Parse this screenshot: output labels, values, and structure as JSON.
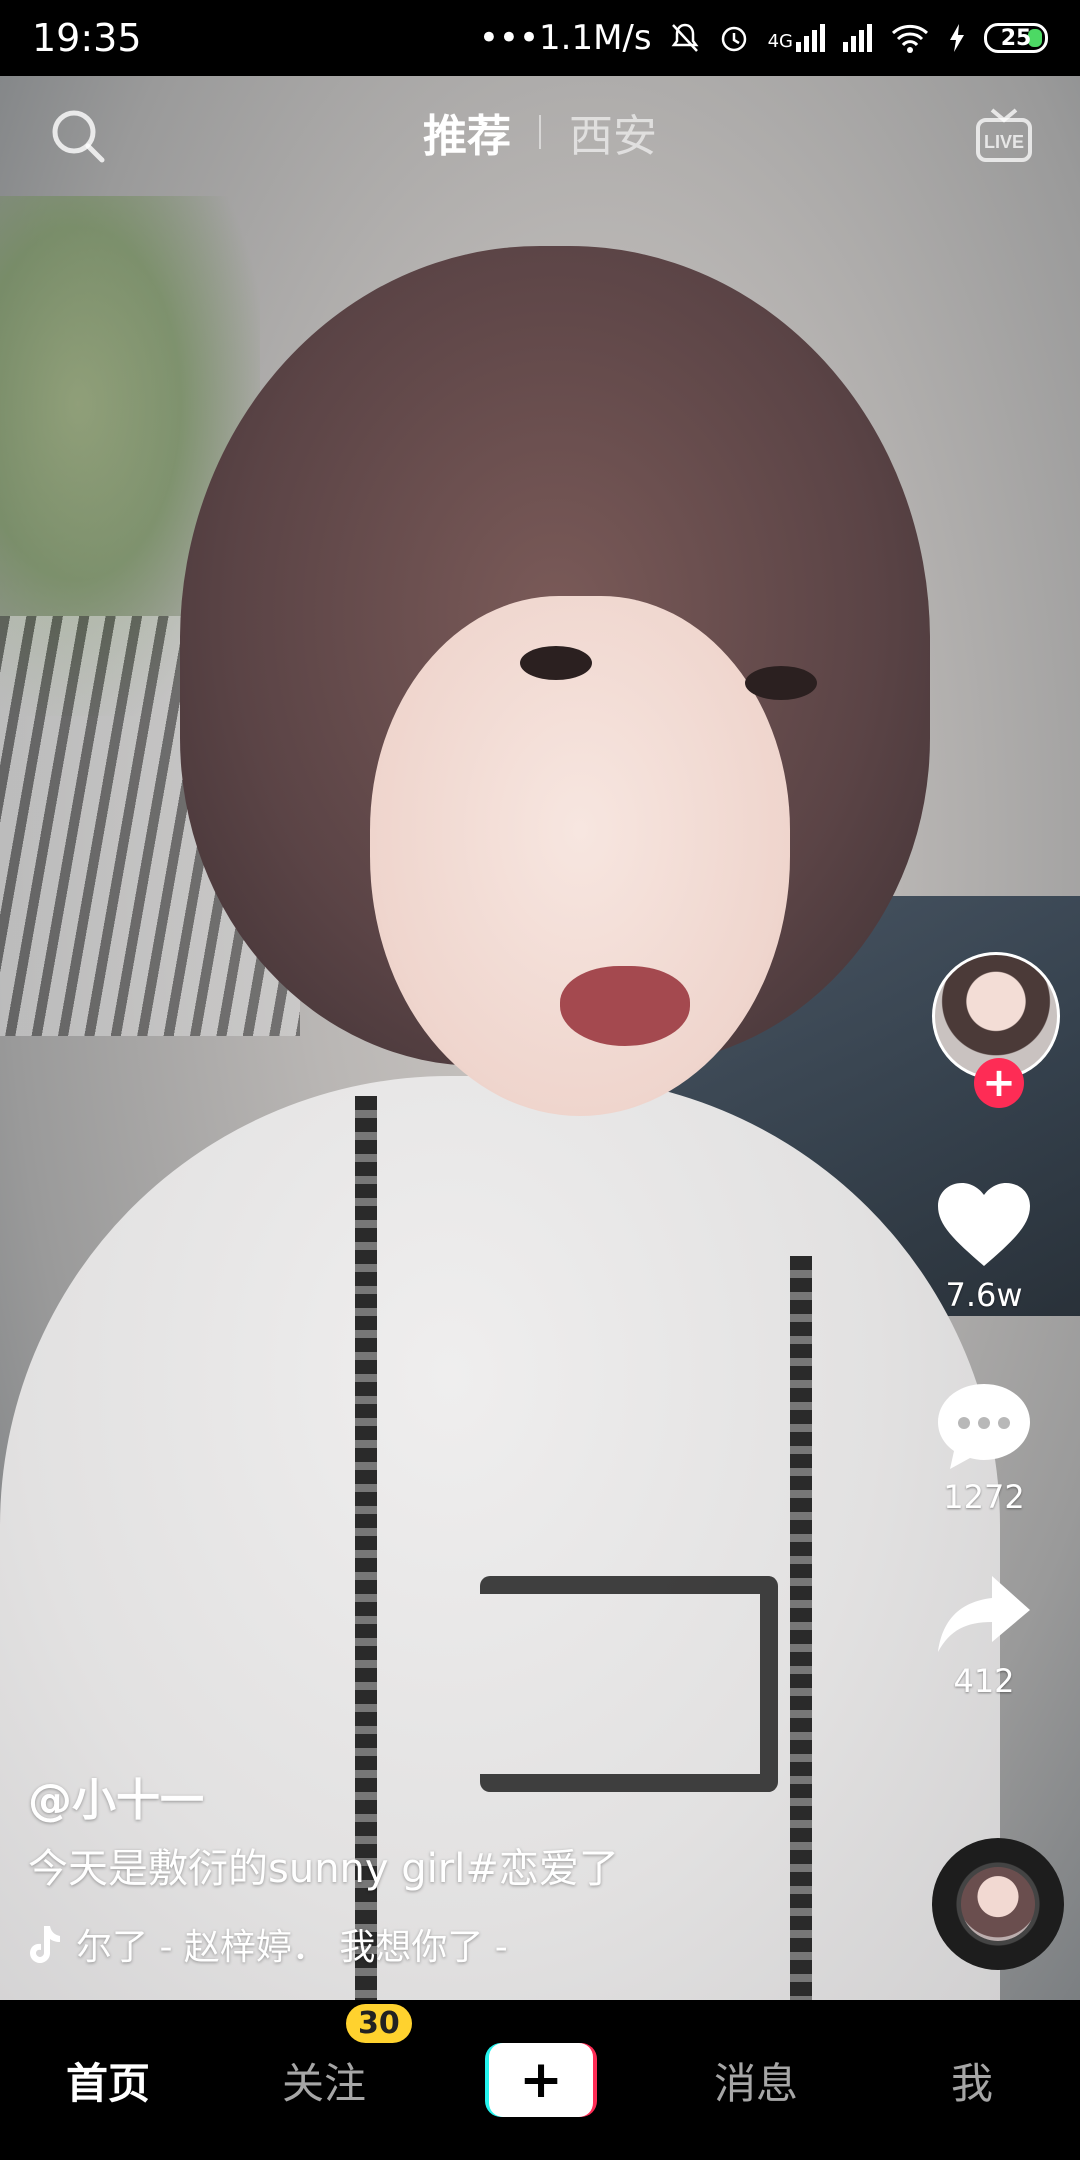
{
  "status_bar": {
    "time": "19:35",
    "network_speed": "•••1.1M/s",
    "signal_label": "4G",
    "battery": "25"
  },
  "top_tabs": {
    "items": [
      {
        "label": "推荐",
        "active": true
      },
      {
        "label": "西安",
        "active": false
      }
    ],
    "live_label": "LIVE"
  },
  "video": {
    "username": "@小十一",
    "description": "今天是敷衍的sunny girl#恋爱了",
    "music": "尔了 - 赵梓婷．  我想你了 -"
  },
  "right_rail": {
    "likes": "7.6w",
    "comments": "1272",
    "shares": "412"
  },
  "bottom_nav": {
    "items": [
      {
        "label": "首页",
        "active": true
      },
      {
        "label": "关注",
        "badge": "30"
      },
      {
        "label": "+"
      },
      {
        "label": "消息"
      },
      {
        "label": "我"
      }
    ]
  },
  "colors": {
    "accent_red": "#fe2c55",
    "accent_cyan": "#25f4ee",
    "badge_yellow": "#ffd22e",
    "battery_green": "#4cd964"
  },
  "icons": [
    "search-icon",
    "live-icon",
    "heart-icon",
    "comment-icon",
    "share-icon",
    "music-note-icon",
    "plus-icon",
    "bell-muted-icon",
    "alarm-icon",
    "wifi-icon",
    "charging-icon"
  ]
}
